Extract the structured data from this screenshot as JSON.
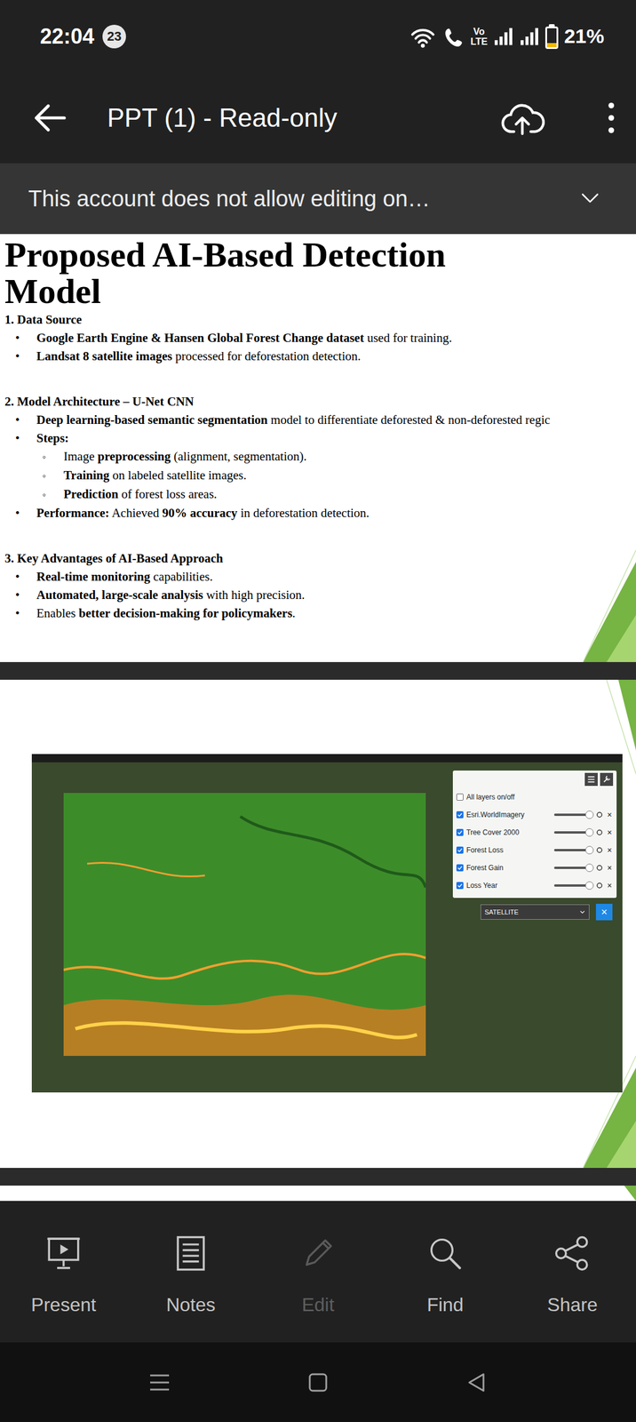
{
  "status_bar": {
    "time": "22:04",
    "notification_count": "23",
    "volte_top": "Vo",
    "volte_bottom": "LTE",
    "battery": "21%",
    "battery_level": 0.21
  },
  "app_bar": {
    "title": "PPT (1) - Read-only"
  },
  "banner": {
    "text": "This account does not allow editing on…"
  },
  "slides": [
    {
      "kind": "text",
      "title": "Proposed AI-Based Detection Model",
      "sections": [
        {
          "heading": "1. Data Source",
          "bullets": [
            {
              "level": 1,
              "marker": "•",
              "segments": [
                {
                  "text": "Google Earth Engine & Hansen Global Forest Change dataset",
                  "bold": true
                },
                {
                  "text": " used for training.",
                  "bold": false
                }
              ]
            },
            {
              "level": 1,
              "marker": "•",
              "segments": [
                {
                  "text": "Landsat 8 satellite images",
                  "bold": true
                },
                {
                  "text": " processed for deforestation detection.",
                  "bold": false
                }
              ]
            }
          ]
        },
        {
          "heading": "2. Model Architecture – U-Net CNN",
          "bullets": [
            {
              "level": 1,
              "marker": "•",
              "segments": [
                {
                  "text": "Deep learning-based semantic segmentation",
                  "bold": true
                },
                {
                  "text": " model to differentiate deforested & non-deforested regic",
                  "bold": false
                }
              ]
            },
            {
              "level": 1,
              "marker": "•",
              "segments": [
                {
                  "text": "Steps:",
                  "bold": true
                }
              ]
            },
            {
              "level": 2,
              "marker": "◦",
              "segments": [
                {
                  "text": "Image ",
                  "bold": false
                },
                {
                  "text": "preprocessing",
                  "bold": true
                },
                {
                  "text": " (alignment, segmentation).",
                  "bold": false
                }
              ]
            },
            {
              "level": 2,
              "marker": "◦",
              "segments": [
                {
                  "text": "Training",
                  "bold": true
                },
                {
                  "text": " on labeled satellite images.",
                  "bold": false
                }
              ]
            },
            {
              "level": 2,
              "marker": "◦",
              "segments": [
                {
                  "text": "Prediction",
                  "bold": true
                },
                {
                  "text": " of forest loss areas.",
                  "bold": false
                }
              ]
            },
            {
              "level": 1,
              "marker": "•",
              "segments": [
                {
                  "text": "Performance:",
                  "bold": true
                },
                {
                  "text": " Achieved ",
                  "bold": false
                },
                {
                  "text": "90% accuracy",
                  "bold": true
                },
                {
                  "text": " in deforestation detection.",
                  "bold": false
                }
              ]
            }
          ]
        },
        {
          "heading": "3. Key Advantages of AI-Based Approach",
          "bullets": [
            {
              "level": 1,
              "marker": "•",
              "segments": [
                {
                  "text": "Real-time monitoring",
                  "bold": true
                },
                {
                  "text": " capabilities.",
                  "bold": false
                }
              ]
            },
            {
              "level": 1,
              "marker": "•",
              "segments": [
                {
                  "text": "Automated, large-scale analysis",
                  "bold": true
                },
                {
                  "text": " with high precision.",
                  "bold": false
                }
              ]
            },
            {
              "level": 1,
              "marker": "•",
              "segments": [
                {
                  "text": "Enables ",
                  "bold": false
                },
                {
                  "text": "better decision-making for policymakers",
                  "bold": true
                },
                {
                  "text": ".",
                  "bold": false
                }
              ]
            }
          ]
        }
      ]
    },
    {
      "kind": "map",
      "layers": [
        {
          "kind": "toggle-all",
          "label": "All layers on/off",
          "checked": false
        },
        {
          "kind": "layer",
          "label": "Esri.WorldImagery",
          "checked": true,
          "level": 1.0,
          "remove": "×"
        },
        {
          "kind": "layer",
          "label": "Tree Cover 2000",
          "checked": true,
          "level": 1.0,
          "remove": "×"
        },
        {
          "kind": "layer",
          "label": "Forest Loss",
          "checked": true,
          "level": 1.0,
          "remove": "×"
        },
        {
          "kind": "layer",
          "label": "Forest Gain",
          "checked": true,
          "level": 1.0,
          "remove": "×"
        },
        {
          "kind": "layer",
          "label": "Loss Year",
          "checked": true,
          "level": 1.0,
          "remove": "×"
        }
      ],
      "basemap": "SATELLITE",
      "close": "×"
    }
  ],
  "toolbar": [
    {
      "label": "Present",
      "disabled": false
    },
    {
      "label": "Notes",
      "disabled": false
    },
    {
      "label": "Edit",
      "disabled": true
    },
    {
      "label": "Find",
      "disabled": false
    },
    {
      "label": "Share",
      "disabled": false
    }
  ]
}
